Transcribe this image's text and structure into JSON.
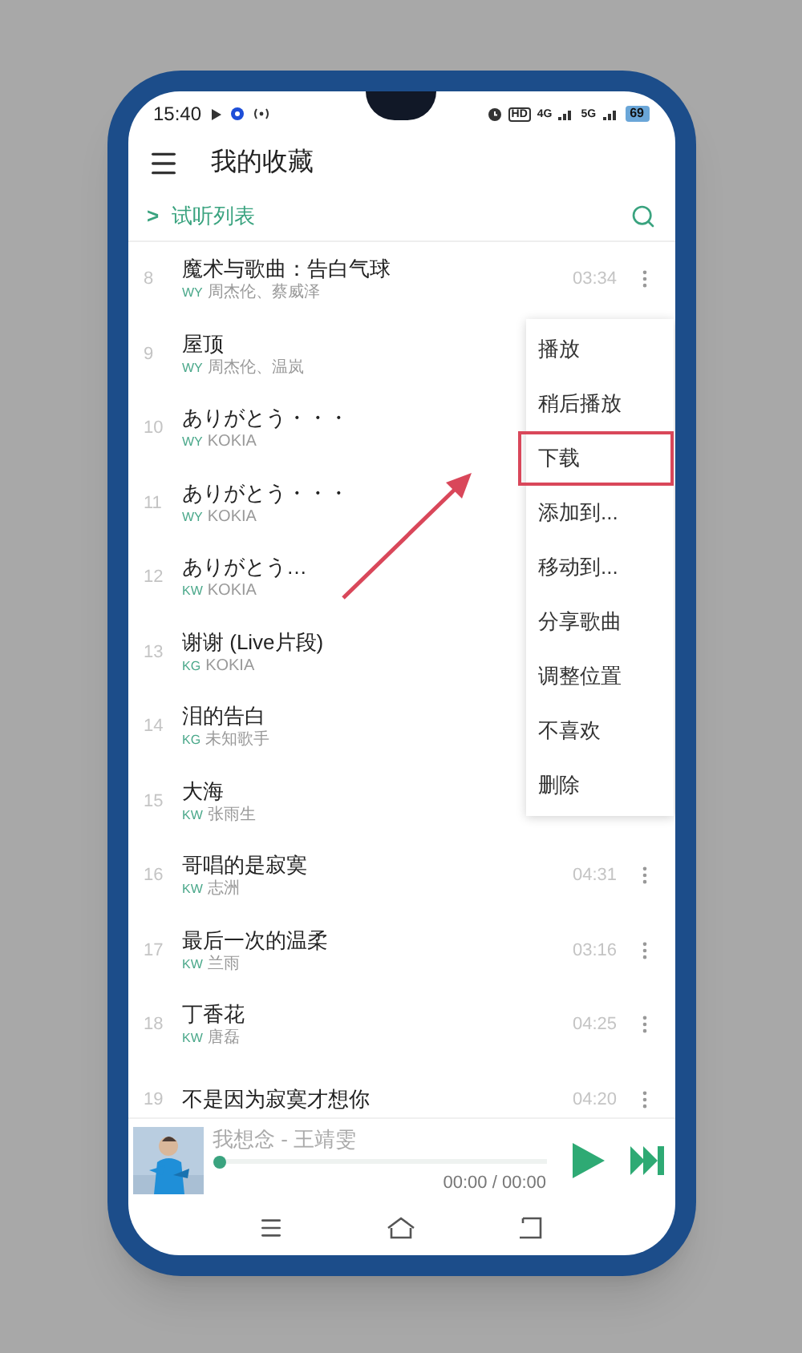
{
  "status_bar": {
    "time": "15:40",
    "hd": "HD",
    "network_1": "4G",
    "network_2": "5G",
    "battery": "69"
  },
  "header": {
    "title": "我的收藏"
  },
  "playlist": {
    "expand_icon": ">",
    "label": "试听列表"
  },
  "songs": [
    {
      "number": "8",
      "title": "魔术与歌曲：告白气球",
      "source": "WY",
      "artist": "周杰伦、蔡威泽",
      "duration": "03:34"
    },
    {
      "number": "9",
      "title": "屋顶",
      "source": "WY",
      "artist": "周杰伦、温岚"
    },
    {
      "number": "10",
      "title": "ありがとう・・・",
      "source": "WY",
      "artist": "KOKIA"
    },
    {
      "number": "11",
      "title": "ありがとう・・・",
      "source": "WY",
      "artist": "KOKIA"
    },
    {
      "number": "12",
      "title": "ありがとう…",
      "source": "KW",
      "artist": "KOKIA"
    },
    {
      "number": "13",
      "title": "谢谢 (Live片段)",
      "source": "KG",
      "artist": "KOKIA"
    },
    {
      "number": "14",
      "title": "泪的告白",
      "source": "KG",
      "artist": "未知歌手"
    },
    {
      "number": "15",
      "title": "大海",
      "source": "KW",
      "artist": "张雨生"
    },
    {
      "number": "16",
      "title": "哥唱的是寂寞",
      "source": "KW",
      "artist": "志洲",
      "duration": "04:31"
    },
    {
      "number": "17",
      "title": "最后一次的温柔",
      "source": "KW",
      "artist": "兰雨",
      "duration": "03:16"
    },
    {
      "number": "18",
      "title": "丁香花",
      "source": "KW",
      "artist": "唐磊",
      "duration": "04:25"
    },
    {
      "number": "19",
      "title": "不是因为寂寞才想你",
      "duration": "04:20"
    }
  ],
  "menu": {
    "items": [
      {
        "label": "播放",
        "highlighted": false
      },
      {
        "label": "稍后播放",
        "highlighted": false
      },
      {
        "label": "下载",
        "highlighted": true
      },
      {
        "label": "添加到...",
        "highlighted": false
      },
      {
        "label": "移动到...",
        "highlighted": false
      },
      {
        "label": "分享歌曲",
        "highlighted": false
      },
      {
        "label": "调整位置",
        "highlighted": false
      },
      {
        "label": "不喜欢",
        "highlighted": false
      },
      {
        "label": "删除",
        "highlighted": false
      }
    ]
  },
  "player": {
    "title": "我想念 - 王靖雯",
    "level": 0,
    "time": "00:00 / 00:00"
  }
}
